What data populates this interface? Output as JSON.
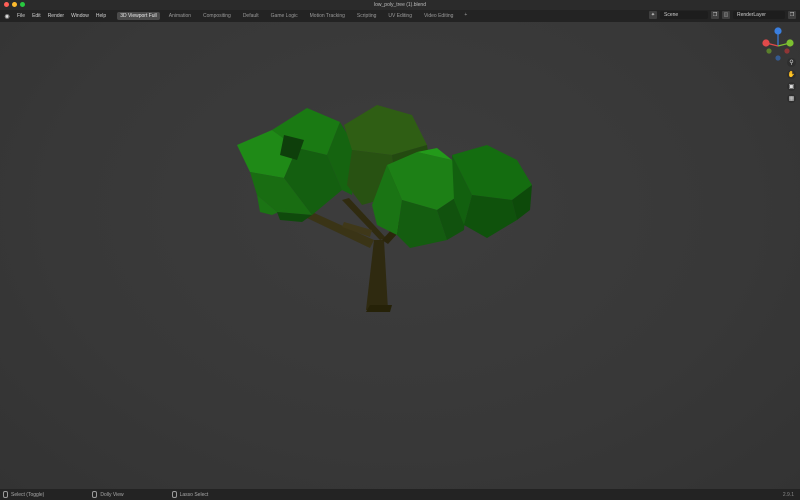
{
  "window": {
    "title": "low_poly_tree (1).blend"
  },
  "menu": [
    "File",
    "Edit",
    "Render",
    "Window",
    "Help"
  ],
  "workspaces": [
    {
      "label": "3D Viewport Full",
      "active": true
    },
    {
      "label": "Animation",
      "active": false
    },
    {
      "label": "Compositing",
      "active": false
    },
    {
      "label": "Default",
      "active": false
    },
    {
      "label": "Game Logic",
      "active": false
    },
    {
      "label": "Motion Tracking",
      "active": false
    },
    {
      "label": "Scripting",
      "active": false
    },
    {
      "label": "UV Editing",
      "active": false
    },
    {
      "label": "Video Editing",
      "active": false
    }
  ],
  "workspaces_more": "+",
  "header_right": {
    "scene": "Scene",
    "view_layer": "RenderLayer"
  },
  "icons": {
    "blender": "blender-logo-icon",
    "scene": "scene-icon",
    "new_scene": "copy-icon",
    "view_layer": "render-layer-icon",
    "new_layer": "copy-icon"
  },
  "nav_buttons": [
    {
      "name": "zoom",
      "glyph": "⚲"
    },
    {
      "name": "pan",
      "glyph": "✋"
    },
    {
      "name": "camera",
      "glyph": "▣"
    },
    {
      "name": "ortho",
      "glyph": "▦"
    }
  ],
  "status": {
    "select": "Select (Toggle)",
    "pan": "Dolly View",
    "lasso": "Lasso Select",
    "version": "2.9.1"
  },
  "colors": {
    "viewport_bg": "#3a3a3a",
    "foliage_light": "#1f8a17",
    "foliage_dark": "#114d0e",
    "trunk": "#2f2a10",
    "gizmo_x": "#e04a4a",
    "gizmo_y": "#7cc030",
    "gizmo_z": "#3a7fe0"
  }
}
